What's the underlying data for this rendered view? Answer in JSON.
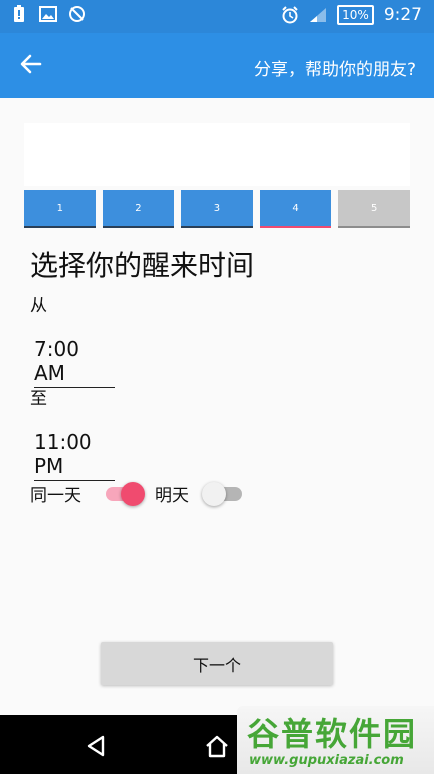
{
  "status_bar": {
    "battery": "10%",
    "time": "9:27",
    "left_icons": [
      "battery-alert-icon",
      "image-icon",
      "no-sync-icon"
    ],
    "right_icons": [
      "alarm-icon",
      "signal-icon",
      "battery-icon"
    ]
  },
  "app_bar": {
    "back_icon": "arrow-left-icon",
    "share_text": "分享，帮助你的朋友?"
  },
  "steps": [
    "1",
    "2",
    "3",
    "4",
    "5"
  ],
  "form": {
    "title": "选择你的醒来时间",
    "from_label": "从",
    "from_value": "7:00 AM",
    "to_label": "至",
    "to_value": "11:00 PM",
    "same_day_label": "同一天",
    "same_day_on": true,
    "tomorrow_label": "明天",
    "tomorrow_on": false
  },
  "next_button": "下一个",
  "nav": {
    "icons": [
      "back-triangle-icon",
      "home-icon"
    ]
  },
  "watermark": {
    "main": "谷普软件园",
    "url": "www.gupuxiazai.com"
  },
  "colors": {
    "status_bar": "#2c87d9",
    "app_bar": "#2d8fe5",
    "accent_pink": "#f04b6f",
    "step_blue": "#3d8fdd",
    "step_disabled": "#c7c7c7"
  }
}
